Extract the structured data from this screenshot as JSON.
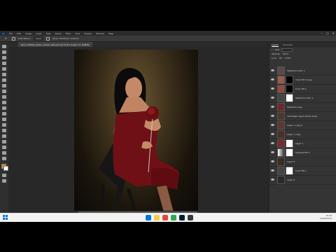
{
  "window": {
    "app_logo": "Ps",
    "menu": [
      "File",
      "Edit",
      "Image",
      "Layer",
      "Type",
      "Select",
      "Filter",
      "View",
      "Plugins",
      "Window",
      "Help"
    ],
    "window_controls": [
      "–",
      "□",
      "✕"
    ]
  },
  "options_bar": {
    "auto_select": "Auto-Select:",
    "layer_dropdown": "Layer",
    "transform_controls": "Show Transform Controls"
  },
  "document": {
    "tab_title": "fgirl_rosflahe_photo_vahe2_vahe.psd @ 24,8% (Layer 17, RGB/8)"
  },
  "status": {
    "text": "24,79%   5400 px x 8100 px (72 ppi)"
  },
  "layers_panel": {
    "tabs": [
      "Layers",
      "Channels"
    ],
    "search_placeholder": "Kind",
    "opacity_label": "Opacity:",
    "opacity_value": "100%",
    "fill_label": "Fill:",
    "fill_value": "100%",
    "lock_label": "Lock:",
    "layers": [
      {
        "name": "Selective Color 1",
        "thumb": "#5a4a43"
      },
      {
        "name": "Color Fill 2 copy",
        "thumb": "#9b5a4a"
      },
      {
        "name": "Color Fill 1",
        "thumb": "#8e4c3c"
      },
      {
        "name": "Selective Color 1",
        "thumb": "#ffffff"
      },
      {
        "name": "Selective copy",
        "thumb": "#6a2a2a"
      },
      {
        "name": "remodept copy's Outer Glow",
        "thumb": "#4a3a2a"
      },
      {
        "name": "Layer 1 copy 2",
        "thumb": "#5a3a30"
      },
      {
        "name": "Layer 1 copy",
        "thumb": "#4a3026"
      },
      {
        "name": "Layer 1",
        "thumb": "#7a2a2a"
      },
      {
        "name": "Gradient Fill 1",
        "thumb": "#777777"
      },
      {
        "name": "Layer 0",
        "thumb": "#3a2e22"
      },
      {
        "name": "Color Fill 1",
        "thumb": "#ffffff"
      },
      {
        "name": "Layer 0",
        "thumb": "#2a2a2a"
      }
    ],
    "footer_icons": [
      "fx",
      "◐",
      "▢",
      "📁",
      "+",
      "🗑"
    ]
  },
  "taskbar": {
    "time": "15:20",
    "date": "10/06/2023"
  }
}
